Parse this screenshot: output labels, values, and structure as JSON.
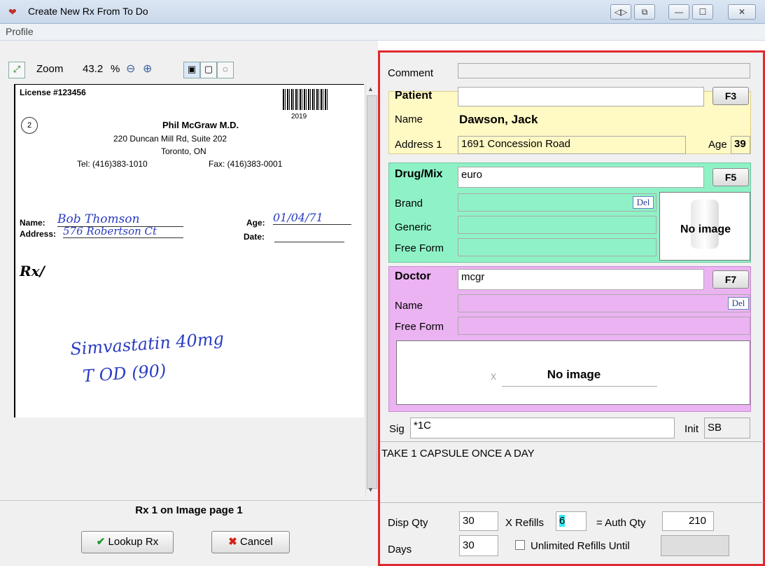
{
  "window": {
    "title": "Create New Rx From To Do",
    "menu": "Profile",
    "buttons": [
      "◁▷",
      "⧉",
      "—",
      "☐",
      "✕"
    ]
  },
  "viewer": {
    "zoom_label": "Zoom",
    "zoom_value": "43.2",
    "zoom_unit": "%",
    "page_caption": "Rx 1 on Image page 1",
    "lookup_label": "Lookup Rx",
    "cancel_label": "Cancel",
    "doc": {
      "license": "License #123456",
      "circle_num": "2",
      "doctor": "Phil McGraw M.D.",
      "addr1": "220 Duncan Mill Rd, Suite 202",
      "addr2": "Toronto, ON",
      "tel": "Tel: (416)383-1010",
      "fax": "Fax: (416)383-0001",
      "year": "2019",
      "name_lbl": "Name:",
      "name_val": "Bob Thomson",
      "addr_lbl": "Address:",
      "addr_val": "576 Robertson Ct",
      "age_lbl": "Age:",
      "age_val": "01/04/71",
      "date_lbl": "Date:",
      "rx": "Rx/",
      "hand1": "Simvastatin 40mg",
      "hand2": "T OD (90)"
    }
  },
  "form": {
    "comment_label": "Comment",
    "patient": {
      "head": "Patient",
      "search": "",
      "key": "F3",
      "name_label": "Name",
      "name": "Dawson, Jack",
      "addr_label": "Address 1",
      "address": "1691 Concession Road",
      "age_label": "Age",
      "age": "39"
    },
    "drug": {
      "head": "Drug/Mix",
      "search": "euro",
      "key": "F5",
      "brand_label": "Brand",
      "generic_label": "Generic",
      "free_label": "Free Form",
      "del": "Del",
      "no_image": "No image"
    },
    "doctor": {
      "head": "Doctor",
      "search": "mcgr",
      "key": "F7",
      "name_label": "Name",
      "free_label": "Free Form",
      "del": "Del",
      "no_image": "No image",
      "x_mark": "x"
    },
    "sig": {
      "label": "Sig",
      "value": "*1C",
      "init_label": "Init",
      "init": "SB",
      "text": "TAKE 1 CAPSULE ONCE A DAY"
    },
    "qty": {
      "disp_label": "Disp Qty",
      "disp": "30",
      "refills_label": "X Refills",
      "refills": "6",
      "auth_label": "= Auth Qty",
      "auth": "210",
      "days_label": "Days",
      "days": "30",
      "unlimited_label": "Unlimited Refills Until"
    }
  },
  "colors": {
    "patient_bg": "#fff9c4",
    "drug_bg": "#8ff2c6",
    "doctor_bg": "#ecb3f2",
    "highlight": "#38e9f0",
    "border_red": "#e0282f"
  }
}
